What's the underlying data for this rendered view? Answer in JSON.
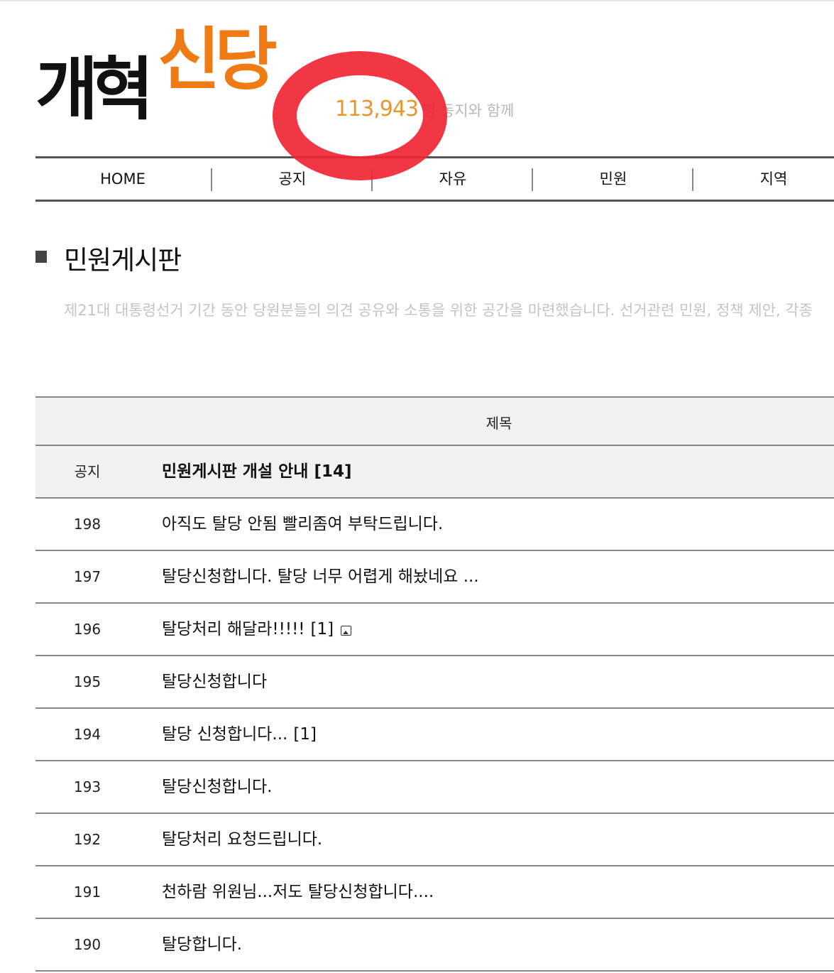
{
  "logo": {
    "black_text": "개혁",
    "orange_text": "신당"
  },
  "members": {
    "count": "113,943",
    "suffix": "명 동지와 함께"
  },
  "nav": [
    "HOME",
    "공지",
    "자유",
    "민원",
    "지역"
  ],
  "board": {
    "title": "민원게시판",
    "description": "제21대 대통령선거 기간 동안 당원분들의 의견 공유와 소통을 위한 공간을 마련했습니다. 선거관련 민원, 정책 제안, 각종"
  },
  "table": {
    "header_title": "제목",
    "rows": [
      {
        "num": "공지",
        "title": "민원게시판 개설 안내",
        "comments": "[14]",
        "has_image": false,
        "notice": true
      },
      {
        "num": "198",
        "title": "아직도 탈당 안됨 빨리좀여 부탁드립니다.",
        "comments": "",
        "has_image": false,
        "notice": false
      },
      {
        "num": "197",
        "title": "탈당신청합니다. 탈당 너무 어렵게 해놨네요 ...",
        "comments": "",
        "has_image": false,
        "notice": false
      },
      {
        "num": "196",
        "title": "탈당처리 해달라!!!!!",
        "comments": "[1]",
        "has_image": true,
        "notice": false
      },
      {
        "num": "195",
        "title": "탈당신청합니다",
        "comments": "",
        "has_image": false,
        "notice": false
      },
      {
        "num": "194",
        "title": "탈당 신청합니다...",
        "comments": "[1]",
        "has_image": false,
        "notice": false
      },
      {
        "num": "193",
        "title": "탈당신청합니다.",
        "comments": "",
        "has_image": false,
        "notice": false
      },
      {
        "num": "192",
        "title": "탈당처리 요청드립니다.",
        "comments": "",
        "has_image": false,
        "notice": false
      },
      {
        "num": "191",
        "title": "천하람 위원님...저도 탈당신청합니다....",
        "comments": "",
        "has_image": false,
        "notice": false
      },
      {
        "num": "190",
        "title": "탈당합니다.",
        "comments": "",
        "has_image": false,
        "notice": false
      }
    ]
  },
  "colors": {
    "brand_orange": "#ee7b14",
    "highlight_red": "#f02634"
  }
}
